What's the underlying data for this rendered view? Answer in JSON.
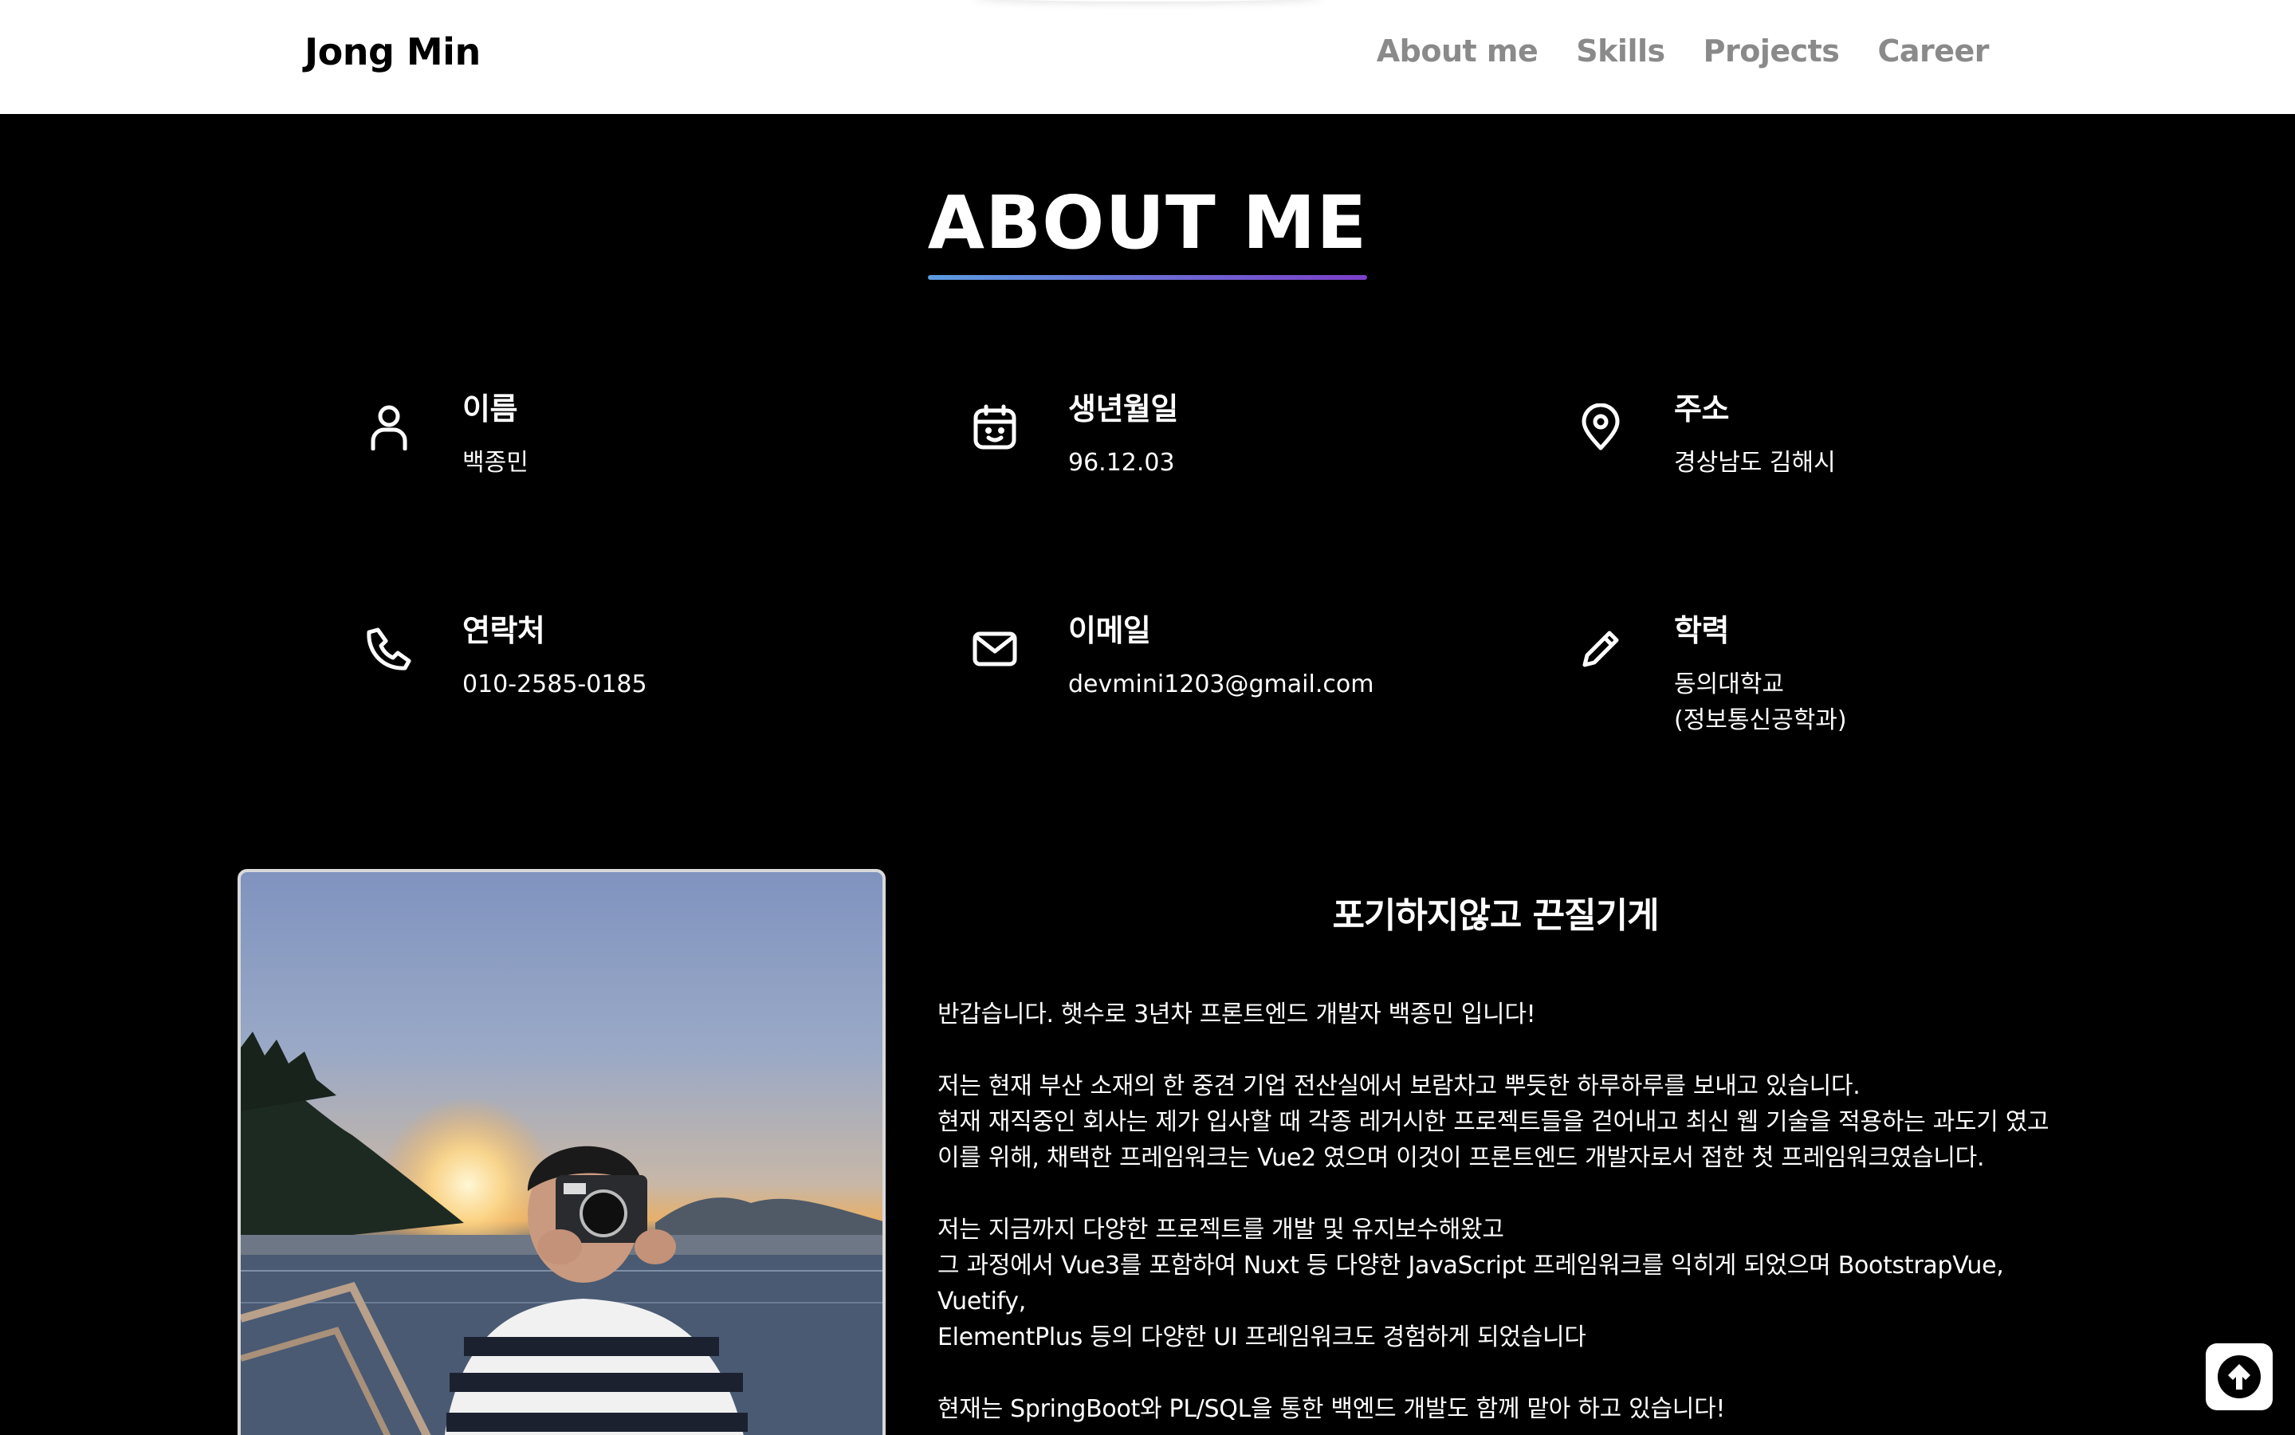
{
  "header": {
    "brand": "Jong Min",
    "nav": [
      "About me",
      "Skills",
      "Projects",
      "Career"
    ]
  },
  "section": {
    "title": "ABOUT ME"
  },
  "info": [
    {
      "icon": "person-icon",
      "label": "이름",
      "value": "백종민"
    },
    {
      "icon": "calendar-icon",
      "label": "생년월일",
      "value": "96.12.03"
    },
    {
      "icon": "location-pin-icon",
      "label": "주소",
      "value": "경상남도 김해시"
    },
    {
      "icon": "phone-icon",
      "label": "연락처",
      "value": "010-2585-0185"
    },
    {
      "icon": "mail-icon",
      "label": "이메일",
      "value": "devmini1203@gmail.com"
    },
    {
      "icon": "pencil-icon",
      "label": "학력",
      "value": "동의대학교\n(정보통신공학과)"
    }
  ],
  "intro": {
    "slogan": "포기하지않고 끈질기게",
    "p1": [
      "반갑습니다. 햇수로 3년차 프론트엔드 개발자 백종민 입니다!"
    ],
    "p2": [
      "저는 현재 부산 소재의 한 중견 기업 전산실에서 보람차고 뿌듯한 하루하루를 보내고 있습니다.",
      "현재 재직중인 회사는 제가 입사할 때 각종 레거시한 프로젝트들을 걷어내고 최신 웹 기술을 적용하는 과도기 였고",
      "이를 위해, 채택한 프레임워크는 Vue2 였으며 이것이 프론트엔드 개발자로서 접한 첫 프레임워크였습니다."
    ],
    "p3": [
      "저는 지금까지 다양한 프로젝트를 개발 및 유지보수해왔고",
      "그 과정에서 Vue3를 포함하여 Nuxt 등 다양한 JavaScript 프레임워크를 익히게 되었으며 BootstrapVue, Vuetify,",
      "ElementPlus 등의 다양한 UI 프레임워크도 경험하게 되었습니다"
    ],
    "p4": [
      "현재는 SpringBoot와 PL/SQL을 통한 백엔드 개발도 함께 맡아 하고 있습니다!"
    ]
  },
  "colors": {
    "underline_start": "#5b9ce0",
    "underline_end": "#7b3fc8"
  }
}
